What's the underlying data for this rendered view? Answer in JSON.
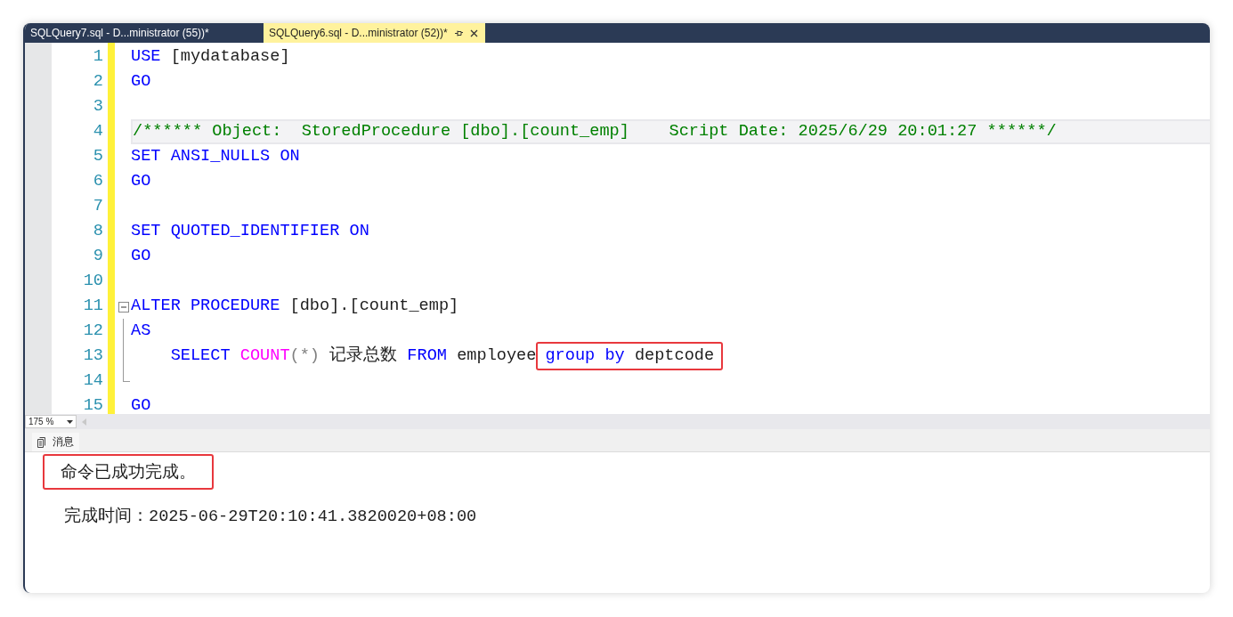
{
  "tabs": [
    {
      "label": "SQLQuery7.sql - D...ministrator (55))*",
      "selected": false
    },
    {
      "label": "SQLQuery6.sql - D...ministrator (52))*",
      "selected": true
    }
  ],
  "editor": {
    "lines": [
      {
        "number": "1",
        "current": false,
        "tokens": [
          {
            "text": "USE",
            "kind": "keyword"
          },
          {
            "text": " [mydatabase]",
            "kind": "plain"
          }
        ]
      },
      {
        "number": "2",
        "current": false,
        "tokens": [
          {
            "text": "GO",
            "kind": "keyword"
          }
        ]
      },
      {
        "number": "3",
        "current": false
      },
      {
        "number": "4",
        "current": true,
        "tokens": [
          {
            "text": "/****** Object:  StoredProcedure [dbo].[count_emp]    Script Date: 2025/6/29 20:01:27 ******/",
            "kind": "comment"
          }
        ]
      },
      {
        "number": "5",
        "current": false,
        "tokens": [
          {
            "text": "SET",
            "kind": "keyword"
          },
          {
            "text": " ANSI_NULLS",
            "kind": "keyword"
          },
          {
            "text": " ON",
            "kind": "keyword"
          }
        ]
      },
      {
        "number": "6",
        "current": false,
        "tokens": [
          {
            "text": "GO",
            "kind": "keyword"
          }
        ]
      },
      {
        "number": "7",
        "current": false
      },
      {
        "number": "8",
        "current": false,
        "tokens": [
          {
            "text": "SET",
            "kind": "keyword"
          },
          {
            "text": " QUOTED_IDENTIFIER",
            "kind": "keyword"
          },
          {
            "text": " ON",
            "kind": "keyword"
          }
        ]
      },
      {
        "number": "9",
        "current": false,
        "tokens": [
          {
            "text": "GO",
            "kind": "keyword"
          }
        ]
      },
      {
        "number": "10",
        "current": false
      },
      {
        "number": "11",
        "current": false,
        "kind": "foldstart",
        "tokens": [
          {
            "text": "ALTER",
            "kind": "keyword"
          },
          {
            "text": " PROCEDURE",
            "kind": "keyword"
          },
          {
            "text": " [dbo].[count_emp]",
            "kind": "plain"
          }
        ]
      },
      {
        "number": "12",
        "current": false,
        "kind": "foldinner",
        "tokens": [
          {
            "text": "AS",
            "kind": "keyword"
          }
        ]
      },
      {
        "number": "13",
        "current": false,
        "kind": "foldinner",
        "tokens": [
          {
            "text": "    SELECT",
            "kind": "keyword"
          },
          {
            "text": " COUNT",
            "kind": "function"
          },
          {
            "text": "(*)",
            "kind": "operator"
          },
          {
            "text": " 记录总数",
            "kind": "plain"
          },
          {
            "text": " FROM",
            "kind": "keyword"
          },
          {
            "text": " employee",
            "kind": "plain"
          }
        ],
        "boxed_tokens": [
          {
            "text": "group",
            "kind": "keyword"
          },
          {
            "text": " by",
            "kind": "keyword"
          },
          {
            "text": " deptcode",
            "kind": "plain"
          }
        ]
      },
      {
        "number": "14",
        "current": false,
        "kind": "foldend"
      },
      {
        "number": "15",
        "current": false,
        "tokens": [
          {
            "text": "GO",
            "kind": "keyword"
          }
        ]
      }
    ]
  },
  "zoom": {
    "value": "175 %"
  },
  "results": {
    "tab": "消息",
    "messages": [
      {
        "kind": "status",
        "boxed": true,
        "text": "命令已成功完成。"
      },
      {
        "kind": "time",
        "boxed": false,
        "label": "完成时间：",
        "text": "2025-06-29T20:10:41.3820020+08:00"
      }
    ]
  }
}
